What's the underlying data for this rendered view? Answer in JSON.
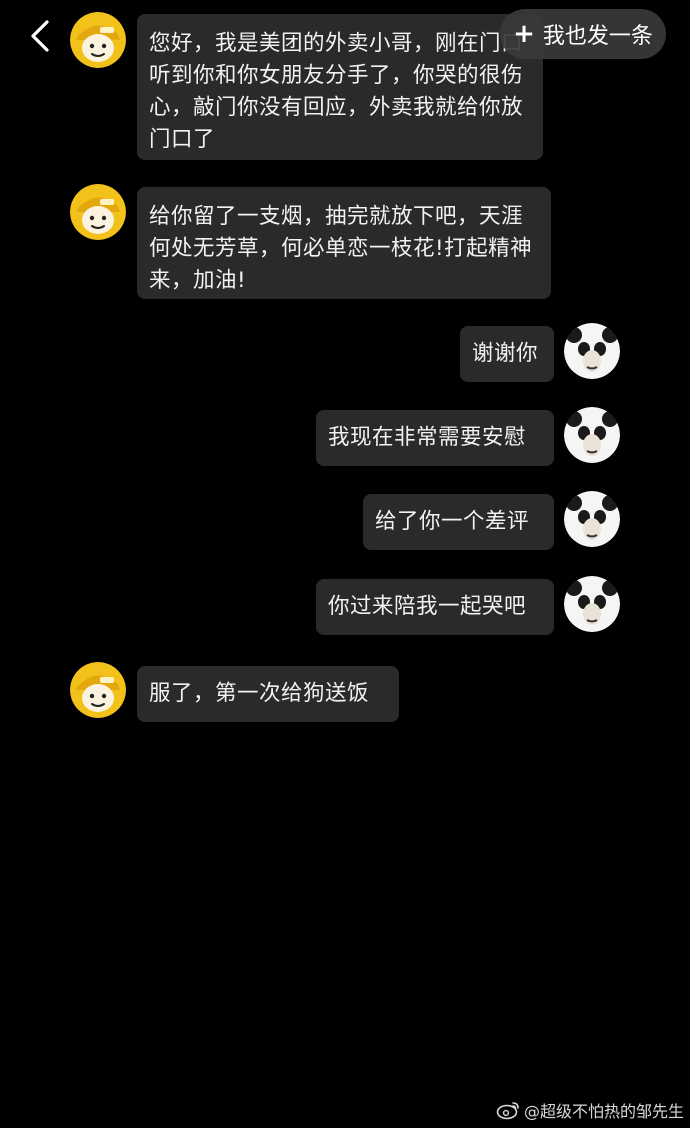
{
  "header": {
    "post_button_label": "我也发一条",
    "post_button_icon": "plus-icon",
    "back_icon": "back-arrow-icon"
  },
  "messages": [
    {
      "side": "left",
      "avatar": "delivery-avatar-icon",
      "text": "您好，我是美团的外卖小哥，刚在门口听到你和你女朋友分手了，你哭的很伤心，敲门你没有回应，外卖我就给你放门口了"
    },
    {
      "side": "left",
      "avatar": "delivery-avatar-icon",
      "text": "给你留了一支烟，抽完就放下吧，天涯何处无芳草，何必单恋一枝花!打起精神来，加油!"
    },
    {
      "side": "right",
      "avatar": "panda-avatar-icon",
      "text": "谢谢你"
    },
    {
      "side": "right",
      "avatar": "panda-avatar-icon",
      "text": "我现在非常需要安慰"
    },
    {
      "side": "right",
      "avatar": "panda-avatar-icon",
      "text": "给了你一个差评"
    },
    {
      "side": "right",
      "avatar": "panda-avatar-icon",
      "text": "你过来陪我一起哭吧"
    },
    {
      "side": "left",
      "avatar": "delivery-avatar-icon",
      "text": "服了，第一次给狗送饭"
    }
  ],
  "watermark": {
    "text": "@超级不怕热的邹先生",
    "icon": "weibo-logo-icon"
  }
}
